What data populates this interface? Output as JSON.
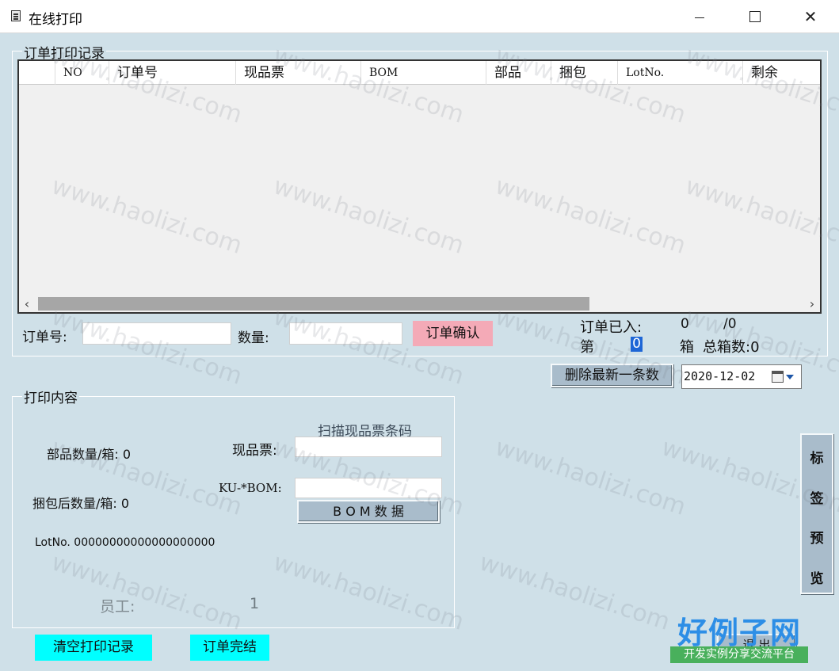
{
  "window": {
    "title": "在线打印",
    "min_glyph": "",
    "close_glyph": "✕"
  },
  "records": {
    "legend": "订单打印记录",
    "columns": [
      "",
      "NO",
      "订单号",
      "现品票",
      "BOM",
      "部品",
      "捆包",
      "LotNo.",
      "剩余"
    ],
    "scroll_left": "‹",
    "scroll_right": "›"
  },
  "order_form": {
    "order_no_label": "订单号:",
    "order_no_value": "",
    "qty_label": "数量:",
    "qty_value": "",
    "confirm_button": "订单确认",
    "entered_label": "订单已入:",
    "entered_count": "0",
    "entered_total": "/0",
    "box_prefix": "第",
    "box_current": "0",
    "box_suffix": "箱",
    "total_boxes": "总箱数:0"
  },
  "actions": {
    "delete_latest": "删除最新一条数",
    "date_value": "2020-12-02"
  },
  "print_content": {
    "legend": "打印内容",
    "scan_hint": "扫描现品票条码",
    "parts_per_box": "部品数量/箱: 0",
    "pack_per_box": "捆包后数量/箱: 0",
    "lotno": "LotNo. 00000000000000000000",
    "genpin_label": "现品票:",
    "genpin_value": "",
    "ku_bom_label": "KU-*BOM:",
    "ku_bom_value": "",
    "bom_button": "B O M 数 据",
    "staff_label": "员工:",
    "staff_value": "1"
  },
  "bottom": {
    "clear_records": "清空打印记录",
    "order_done": "订单完结",
    "exit_button": "退 出"
  },
  "side": {
    "preview_chars": [
      "标",
      "签",
      "预",
      "览"
    ]
  },
  "overlay": {
    "watermark": "www.haolizi.com",
    "brand_title": "好例子网",
    "brand_sub": "开发实例分享交流平台"
  }
}
